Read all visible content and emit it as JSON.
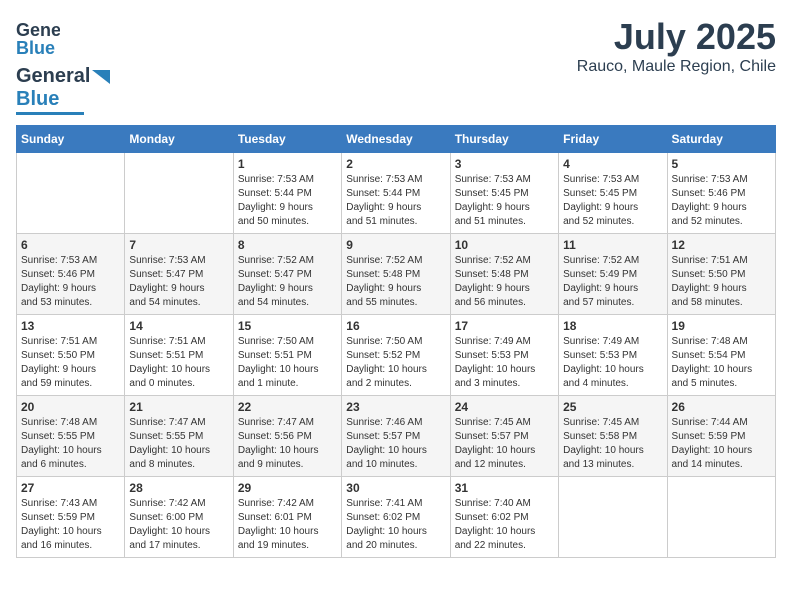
{
  "header": {
    "logo_general": "General",
    "logo_blue": "Blue",
    "month": "July 2025",
    "location": "Rauco, Maule Region, Chile"
  },
  "days_of_week": [
    "Sunday",
    "Monday",
    "Tuesday",
    "Wednesday",
    "Thursday",
    "Friday",
    "Saturday"
  ],
  "weeks": [
    [
      {
        "day": "",
        "detail": ""
      },
      {
        "day": "",
        "detail": ""
      },
      {
        "day": "1",
        "detail": "Sunrise: 7:53 AM\nSunset: 5:44 PM\nDaylight: 9 hours\nand 50 minutes."
      },
      {
        "day": "2",
        "detail": "Sunrise: 7:53 AM\nSunset: 5:44 PM\nDaylight: 9 hours\nand 51 minutes."
      },
      {
        "day": "3",
        "detail": "Sunrise: 7:53 AM\nSunset: 5:45 PM\nDaylight: 9 hours\nand 51 minutes."
      },
      {
        "day": "4",
        "detail": "Sunrise: 7:53 AM\nSunset: 5:45 PM\nDaylight: 9 hours\nand 52 minutes."
      },
      {
        "day": "5",
        "detail": "Sunrise: 7:53 AM\nSunset: 5:46 PM\nDaylight: 9 hours\nand 52 minutes."
      }
    ],
    [
      {
        "day": "6",
        "detail": "Sunrise: 7:53 AM\nSunset: 5:46 PM\nDaylight: 9 hours\nand 53 minutes."
      },
      {
        "day": "7",
        "detail": "Sunrise: 7:53 AM\nSunset: 5:47 PM\nDaylight: 9 hours\nand 54 minutes."
      },
      {
        "day": "8",
        "detail": "Sunrise: 7:52 AM\nSunset: 5:47 PM\nDaylight: 9 hours\nand 54 minutes."
      },
      {
        "day": "9",
        "detail": "Sunrise: 7:52 AM\nSunset: 5:48 PM\nDaylight: 9 hours\nand 55 minutes."
      },
      {
        "day": "10",
        "detail": "Sunrise: 7:52 AM\nSunset: 5:48 PM\nDaylight: 9 hours\nand 56 minutes."
      },
      {
        "day": "11",
        "detail": "Sunrise: 7:52 AM\nSunset: 5:49 PM\nDaylight: 9 hours\nand 57 minutes."
      },
      {
        "day": "12",
        "detail": "Sunrise: 7:51 AM\nSunset: 5:50 PM\nDaylight: 9 hours\nand 58 minutes."
      }
    ],
    [
      {
        "day": "13",
        "detail": "Sunrise: 7:51 AM\nSunset: 5:50 PM\nDaylight: 9 hours\nand 59 minutes."
      },
      {
        "day": "14",
        "detail": "Sunrise: 7:51 AM\nSunset: 5:51 PM\nDaylight: 10 hours\nand 0 minutes."
      },
      {
        "day": "15",
        "detail": "Sunrise: 7:50 AM\nSunset: 5:51 PM\nDaylight: 10 hours\nand 1 minute."
      },
      {
        "day": "16",
        "detail": "Sunrise: 7:50 AM\nSunset: 5:52 PM\nDaylight: 10 hours\nand 2 minutes."
      },
      {
        "day": "17",
        "detail": "Sunrise: 7:49 AM\nSunset: 5:53 PM\nDaylight: 10 hours\nand 3 minutes."
      },
      {
        "day": "18",
        "detail": "Sunrise: 7:49 AM\nSunset: 5:53 PM\nDaylight: 10 hours\nand 4 minutes."
      },
      {
        "day": "19",
        "detail": "Sunrise: 7:48 AM\nSunset: 5:54 PM\nDaylight: 10 hours\nand 5 minutes."
      }
    ],
    [
      {
        "day": "20",
        "detail": "Sunrise: 7:48 AM\nSunset: 5:55 PM\nDaylight: 10 hours\nand 6 minutes."
      },
      {
        "day": "21",
        "detail": "Sunrise: 7:47 AM\nSunset: 5:55 PM\nDaylight: 10 hours\nand 8 minutes."
      },
      {
        "day": "22",
        "detail": "Sunrise: 7:47 AM\nSunset: 5:56 PM\nDaylight: 10 hours\nand 9 minutes."
      },
      {
        "day": "23",
        "detail": "Sunrise: 7:46 AM\nSunset: 5:57 PM\nDaylight: 10 hours\nand 10 minutes."
      },
      {
        "day": "24",
        "detail": "Sunrise: 7:45 AM\nSunset: 5:57 PM\nDaylight: 10 hours\nand 12 minutes."
      },
      {
        "day": "25",
        "detail": "Sunrise: 7:45 AM\nSunset: 5:58 PM\nDaylight: 10 hours\nand 13 minutes."
      },
      {
        "day": "26",
        "detail": "Sunrise: 7:44 AM\nSunset: 5:59 PM\nDaylight: 10 hours\nand 14 minutes."
      }
    ],
    [
      {
        "day": "27",
        "detail": "Sunrise: 7:43 AM\nSunset: 5:59 PM\nDaylight: 10 hours\nand 16 minutes."
      },
      {
        "day": "28",
        "detail": "Sunrise: 7:42 AM\nSunset: 6:00 PM\nDaylight: 10 hours\nand 17 minutes."
      },
      {
        "day": "29",
        "detail": "Sunrise: 7:42 AM\nSunset: 6:01 PM\nDaylight: 10 hours\nand 19 minutes."
      },
      {
        "day": "30",
        "detail": "Sunrise: 7:41 AM\nSunset: 6:02 PM\nDaylight: 10 hours\nand 20 minutes."
      },
      {
        "day": "31",
        "detail": "Sunrise: 7:40 AM\nSunset: 6:02 PM\nDaylight: 10 hours\nand 22 minutes."
      },
      {
        "day": "",
        "detail": ""
      },
      {
        "day": "",
        "detail": ""
      }
    ]
  ]
}
